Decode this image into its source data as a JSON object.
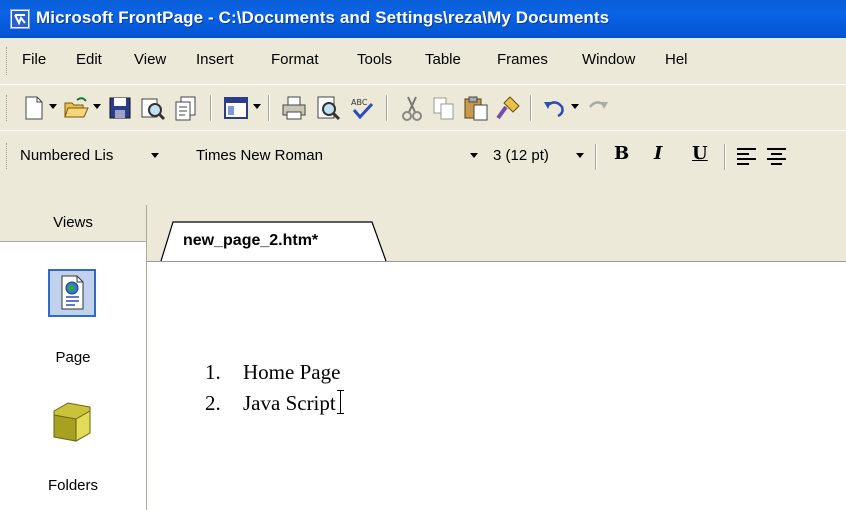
{
  "window": {
    "title": "Microsoft FrontPage - C:\\Documents and Settings\\reza\\My Documents"
  },
  "menu": {
    "items": [
      {
        "label": "File"
      },
      {
        "label": "Edit"
      },
      {
        "label": "View"
      },
      {
        "label": "Insert"
      },
      {
        "label": "Format"
      },
      {
        "label": "Tools"
      },
      {
        "label": "Table"
      },
      {
        "label": "Frames"
      },
      {
        "label": "Window"
      },
      {
        "label": "Hel"
      }
    ]
  },
  "standard_toolbar": {
    "icons": [
      "new-page-icon",
      "open-folder-icon",
      "save-icon",
      "search-icon",
      "publish-icon",
      "toggle-pane-icon",
      "print-icon",
      "print-preview-icon",
      "spelling-icon",
      "cut-icon",
      "copy-icon",
      "paste-icon",
      "format-painter-icon",
      "undo-icon",
      "redo-icon"
    ]
  },
  "formatting_toolbar": {
    "style_value": "Numbered Lis",
    "font_value": "Times New Roman",
    "size_value": "3  (12 pt)",
    "bold_label": "B",
    "italic_label": "I",
    "underline_label": "U"
  },
  "views_panel": {
    "header": "Views",
    "items": [
      {
        "label": "Page",
        "icon": "page-view-icon",
        "selected": true
      },
      {
        "label": "Folders",
        "icon": "folder-icon",
        "selected": false
      }
    ]
  },
  "editor": {
    "tab_label": "new_page_2.htm*",
    "list_items": [
      {
        "number": "1.",
        "text": "Home Page"
      },
      {
        "number": "2.",
        "text": "Java Script"
      }
    ]
  },
  "colors": {
    "title_bar": "#0a5fd8",
    "chrome": "#ece9d8",
    "selection_border": "#316ac5"
  }
}
